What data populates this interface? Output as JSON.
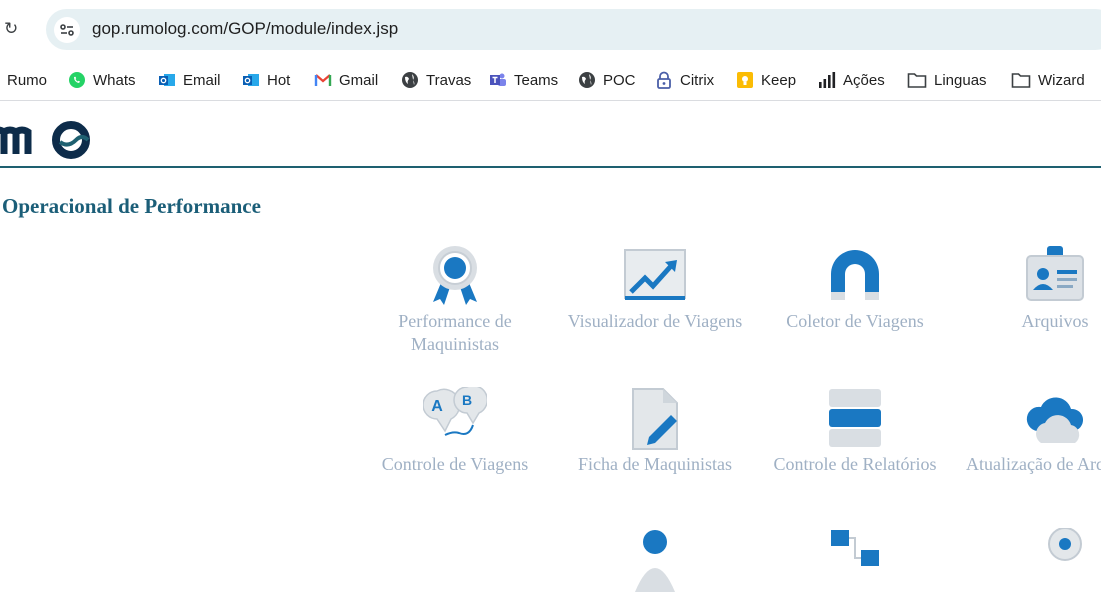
{
  "browser": {
    "url": "gop.rumolog.com/GOP/module/index.jsp"
  },
  "bookmarks": [
    {
      "label": "Rumo",
      "icon": "none"
    },
    {
      "label": "Whats",
      "icon": "whatsapp-icon"
    },
    {
      "label": "Email",
      "icon": "outlook-icon"
    },
    {
      "label": "Hot",
      "icon": "outlook-icon"
    },
    {
      "label": "Gmail",
      "icon": "gmail-icon"
    },
    {
      "label": "Travas",
      "icon": "globe-icon"
    },
    {
      "label": "Teams",
      "icon": "teams-icon"
    },
    {
      "label": "POC",
      "icon": "globe-icon"
    },
    {
      "label": "Citrix",
      "icon": "lock-icon"
    },
    {
      "label": "Keep",
      "icon": "keep-icon"
    },
    {
      "label": "Ações",
      "icon": "bar-chart-icon"
    },
    {
      "label": "Linguas",
      "icon": "folder-icon"
    },
    {
      "label": "Wizard",
      "icon": "folder-icon"
    }
  ],
  "page": {
    "title": "Operacional de Performance",
    "accent_color": "#1b5e78",
    "icon_color": "#1a78c2"
  },
  "tiles": [
    {
      "label": "Performance de Maquinistas",
      "icon": "award-ribbon-icon"
    },
    {
      "label": "Visualizador de Viagens",
      "icon": "trend-chart-icon"
    },
    {
      "label": "Coletor de Viagens",
      "icon": "magnet-icon"
    },
    {
      "label": "Arquivos",
      "icon": "id-badge-icon"
    },
    {
      "label": "Controle de Viagens",
      "icon": "ab-route-icon"
    },
    {
      "label": "Ficha de Maquinistas",
      "icon": "document-edit-icon"
    },
    {
      "label": "Controle de Relatórios",
      "icon": "database-icon"
    },
    {
      "label": "Atualização de Arquivos",
      "icon": "cloud-icon"
    }
  ]
}
